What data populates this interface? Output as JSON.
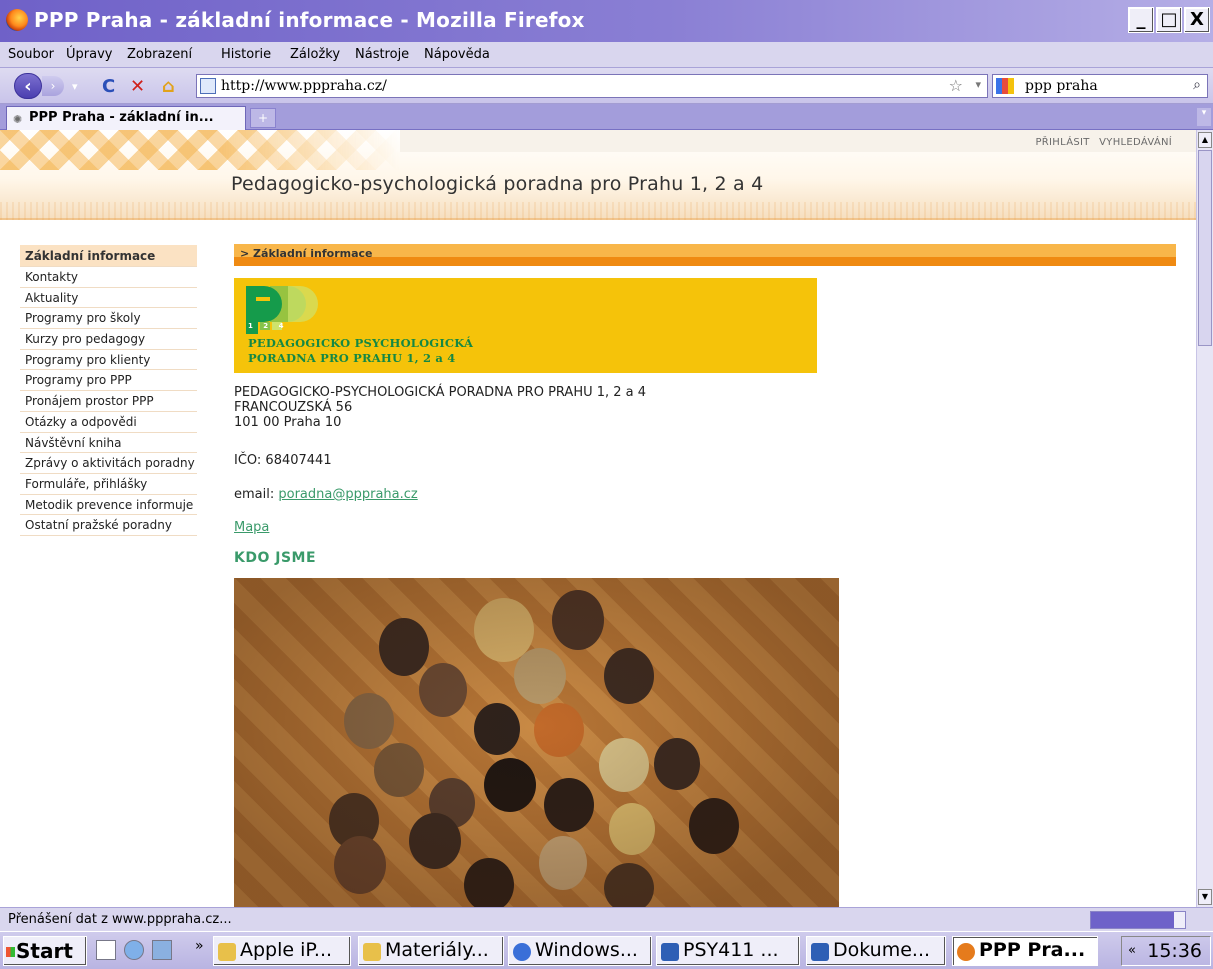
{
  "window": {
    "title": "PPP Praha - základní informace - Mozilla Firefox",
    "minimize": "_",
    "maximize": "□",
    "close": "X"
  },
  "menu": [
    "Soubor",
    "Úpravy",
    "Zobrazení",
    "Historie",
    "Záložky",
    "Nástroje",
    "Nápověda"
  ],
  "nav": {
    "url": "http://www.pppraha.cz/",
    "search_value": "ppp praha",
    "back_icon": "back-arrow-icon",
    "forward_icon": "forward-arrow-icon",
    "reload_icon": "reload-icon",
    "stop_icon": "stop-icon",
    "home_icon": "home-icon"
  },
  "tabs": [
    {
      "label": "PPP Praha - základní in..."
    }
  ],
  "site": {
    "toplinks": [
      "PŘIHLÁSIT",
      "VYHLEDÁVÁNÍ"
    ],
    "title": "Pedagogicko-psychologická poradna pro Prahu 1, 2 a 4"
  },
  "sidebar": {
    "items": [
      {
        "label": "Základní informace",
        "active": true
      },
      {
        "label": "Kontakty"
      },
      {
        "label": "Aktuality"
      },
      {
        "label": "Programy pro školy"
      },
      {
        "label": "Kurzy pro pedagogy"
      },
      {
        "label": "Programy pro klienty"
      },
      {
        "label": "Programy pro PPP"
      },
      {
        "label": "Pronájem prostor PPP"
      },
      {
        "label": "Otázky a odpovědi"
      },
      {
        "label": "Návštěvní kniha"
      },
      {
        "label": "Zprávy o aktivitách poradny"
      },
      {
        "label": "Formuláře, přihlášky"
      },
      {
        "label": "Metodik prevence informuje"
      },
      {
        "label": "Ostatní pražské poradny"
      }
    ]
  },
  "main": {
    "breadcrumb": "> Základní informace",
    "banner": {
      "logo_digits": "1 2 4",
      "line1": "PEDAGOGICKO PSYCHOLOGICKÁ",
      "line2": "PORADNA PRO PRAHU 1, 2 a 4"
    },
    "address": {
      "line1": "PEDAGOGICKO-PSYCHOLOGICKÁ PORADNA PRO PRAHU 1, 2 a 4",
      "line2": "FRANCOUZSKÁ 56",
      "line3": "101 00 Praha 10"
    },
    "ico": "IČO: 68407441",
    "email_label": "email:",
    "email": "poradna@pppraha.cz",
    "map_link": "Mapa",
    "section_heading": "KDO JSME"
  },
  "status": {
    "message": "Přenášení dat z www.pppraha.cz...",
    "progress": 0.88
  },
  "taskbar": {
    "start": "Start",
    "more": "»",
    "tasks": [
      {
        "label": "Apple iP...",
        "icon_color": "#e8c04a"
      },
      {
        "label": "Materiály...",
        "icon_color": "#e8c04a"
      },
      {
        "label": "Windows...",
        "icon_color": "#3a6fd8"
      },
      {
        "label": "PSY411 ...",
        "icon_color": "#2f5fb5"
      },
      {
        "label": "Dokume...",
        "icon_color": "#2f5fb5"
      },
      {
        "label": "PPP Pra...",
        "icon_color": "#e57b1c",
        "active": true
      }
    ],
    "tray_chevron": "«",
    "clock": "15:36"
  },
  "colors": {
    "accent_orange": "#ef8a12",
    "link_green": "#3a9a6a",
    "banner_yellow": "#f5c30a",
    "logo_green": "#159b4b"
  }
}
